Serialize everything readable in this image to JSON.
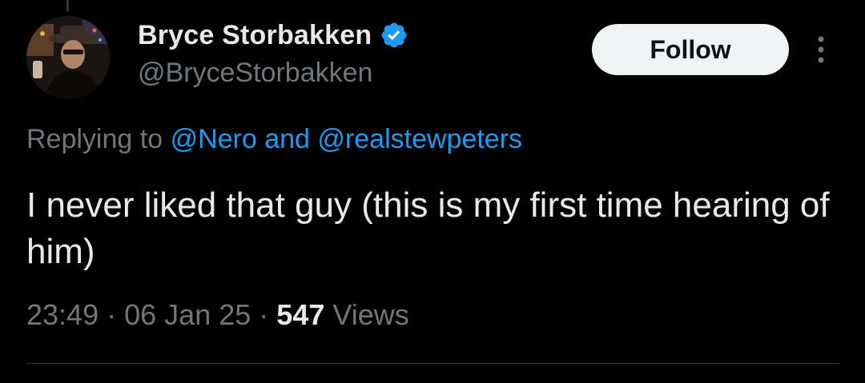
{
  "author": {
    "display_name": "Bryce Storbakken",
    "handle": "@BryceStorbakken",
    "verified": true,
    "verified_badge_icon": "verified-badge-icon",
    "verified_color": "#1d9bf0"
  },
  "actions": {
    "follow_label": "Follow",
    "more_icon": "more-vertical-icon"
  },
  "reply": {
    "prefix": "Replying to",
    "mention_1": "@Nero",
    "connector": "and",
    "mention_2": "@realstewpeters"
  },
  "tweet": {
    "text": "I never liked that guy (this is my first time hearing of him)"
  },
  "meta": {
    "time": "23:49",
    "separator": "·",
    "date": "06 Jan 25",
    "views_count": "547",
    "views_label": "Views"
  },
  "colors": {
    "background": "#000000",
    "primary_text": "#e7e9ea",
    "secondary_text": "#71767b",
    "link": "#1d9bf0",
    "follow_bg": "#eff3f4"
  }
}
